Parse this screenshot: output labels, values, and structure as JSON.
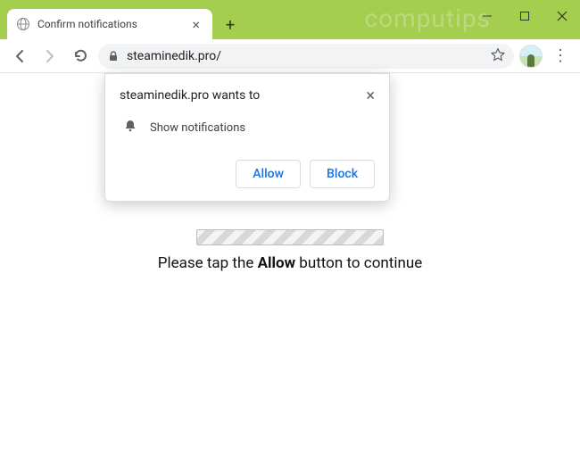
{
  "window": {
    "watermark": "computips"
  },
  "tab": {
    "title": "Confirm notifications"
  },
  "toolbar": {
    "url": "steaminedik.pro/"
  },
  "permission": {
    "prompt": "steaminedik.pro wants to",
    "capability": "Show notifications",
    "allow": "Allow",
    "block": "Block"
  },
  "page": {
    "msg_pre": "Please tap the ",
    "msg_bold": "Allow",
    "msg_post": " button to continue"
  }
}
